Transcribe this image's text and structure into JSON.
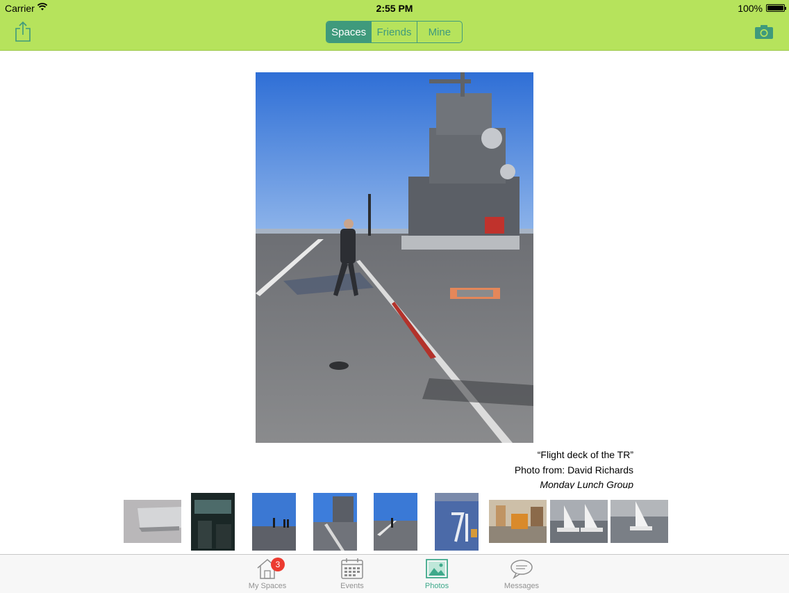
{
  "status_bar": {
    "carrier": "Carrier",
    "time": "2:55 PM",
    "battery": "100%"
  },
  "nav": {
    "segments": [
      {
        "label": "Spaces",
        "selected": true
      },
      {
        "label": "Friends",
        "selected": false
      },
      {
        "label": "Mine",
        "selected": false
      }
    ],
    "share_icon": "share-icon",
    "camera_icon": "camera-icon"
  },
  "photo": {
    "title": "“Flight deck of the TR”",
    "from": "Photo from: David Richards",
    "group": "Monday Lunch Group"
  },
  "thumbnails": [
    {
      "subject": "laptop"
    },
    {
      "subject": "ship bridge interior"
    },
    {
      "subject": "flight deck people"
    },
    {
      "subject": "flight deck tower"
    },
    {
      "subject": "flight deck walking"
    },
    {
      "subject": "hull number 71"
    },
    {
      "subject": "room with equipment"
    },
    {
      "subject": "sailboats"
    },
    {
      "subject": "sailboat"
    }
  ],
  "tabbar": {
    "items": [
      {
        "label": "My Spaces",
        "icon": "house-icon",
        "badge": "3"
      },
      {
        "label": "Events",
        "icon": "calendar-icon"
      },
      {
        "label": "Photos",
        "icon": "photos-icon"
      },
      {
        "label": "Messages",
        "icon": "messages-icon"
      }
    ],
    "active_color": "#3fa98b"
  },
  "colors": {
    "nav_background": "#b6e35c",
    "segment_accent": "#3f9a7c",
    "badge": "#ec3b30"
  }
}
